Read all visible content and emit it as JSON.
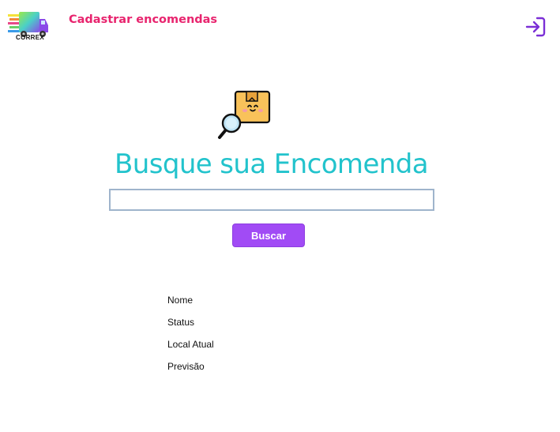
{
  "header": {
    "logo_text": "CORREX",
    "nav_link": "Cadastrar encomendas",
    "login_icon": "login-icon"
  },
  "hero": {
    "icon": "package-search-icon",
    "title": "Busque sua Encomenda"
  },
  "search": {
    "value": "",
    "placeholder": "",
    "button_label": "Buscar"
  },
  "results": {
    "fields": [
      "Nome",
      "Status",
      "Local Atual",
      "Previsão"
    ]
  },
  "colors": {
    "title": "#22c3cc",
    "nav_link": "#e8246e",
    "button": "#a14bf5",
    "login_icon": "#7b2fd6"
  }
}
